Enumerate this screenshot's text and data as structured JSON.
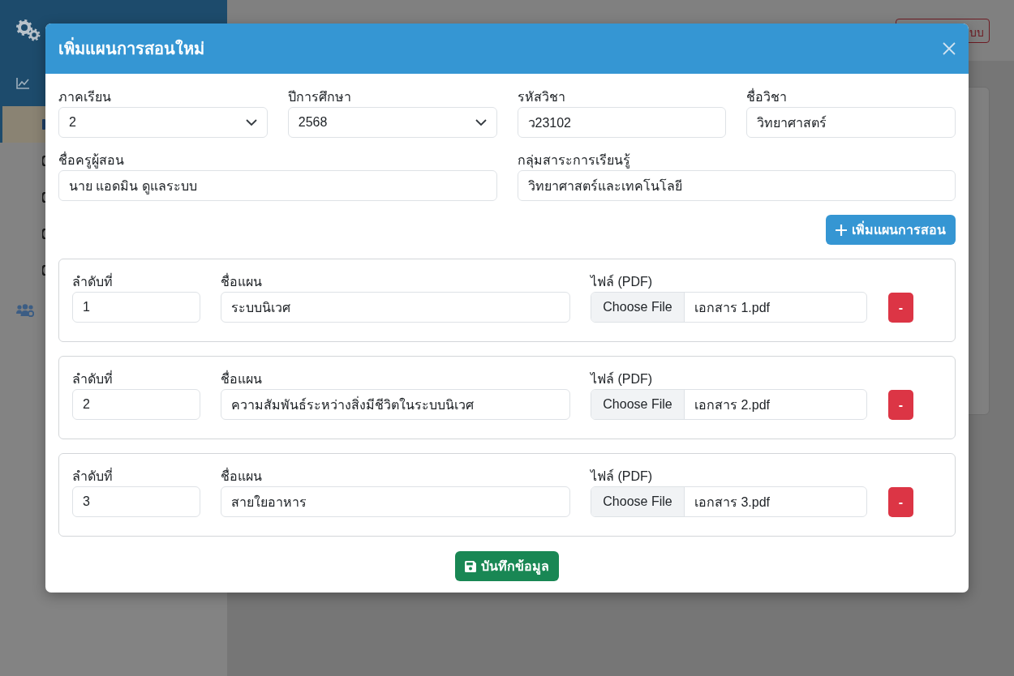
{
  "sidebar": {
    "submenu": [
      {
        "selected": true
      },
      {
        "selected": false
      },
      {
        "selected": false
      },
      {
        "selected": false
      },
      {
        "selected": false
      }
    ]
  },
  "top_bar": {
    "logout_button": "บบ"
  },
  "modal": {
    "title": "เพิ่มแผนการสอนใหม่",
    "field_rows": [
      [
        {
          "label": "ภาคเรียน",
          "kind": "select",
          "value": "2"
        },
        {
          "label": "ปีการศึกษา",
          "kind": "select",
          "value": "2568"
        },
        {
          "label": "รหัสวิชา",
          "kind": "text",
          "value": "ว23102"
        },
        {
          "label": "ชื่อวิชา",
          "kind": "text",
          "value": "วิทยาศาสตร์"
        }
      ],
      [
        {
          "label": "ชื่อครูผู้สอน",
          "kind": "text",
          "value": "นาย แอดมิน ดูแลระบบ"
        },
        {
          "label": "กลุ่มสาระการเรียนรู้",
          "kind": "text",
          "value": "วิทยาศาสตร์และเทคโนโลยี"
        }
      ]
    ],
    "add_button": "เพิ่มแผนการสอน",
    "plans": [
      {
        "order_label": "ลำดับที่",
        "order": "1",
        "name_label": "ชื่อแผน",
        "name": "ระบบนิเวศ",
        "file_label": "ไฟล์ (PDF)",
        "file_button": "Choose File",
        "file_name": "เอกสาร 1.pdf",
        "remove_button": "-"
      },
      {
        "order_label": "ลำดับที่",
        "order": "2",
        "name_label": "ชื่อแผน",
        "name": "ความสัมพันธ์ระหว่างสิ่งมีชีวิตในระบบนิเวศ",
        "file_label": "ไฟล์ (PDF)",
        "file_button": "Choose File",
        "file_name": "เอกสาร 2.pdf",
        "remove_button": "-"
      },
      {
        "order_label": "ลำดับที่",
        "order": "3",
        "name_label": "ชื่อแผน",
        "name": "สายใยอาหาร",
        "file_label": "ไฟล์ (PDF)",
        "file_button": "Choose File",
        "file_name": "เอกสาร 3.pdf",
        "remove_button": "-"
      }
    ],
    "save_button": "บันทึกข้อมูล"
  }
}
